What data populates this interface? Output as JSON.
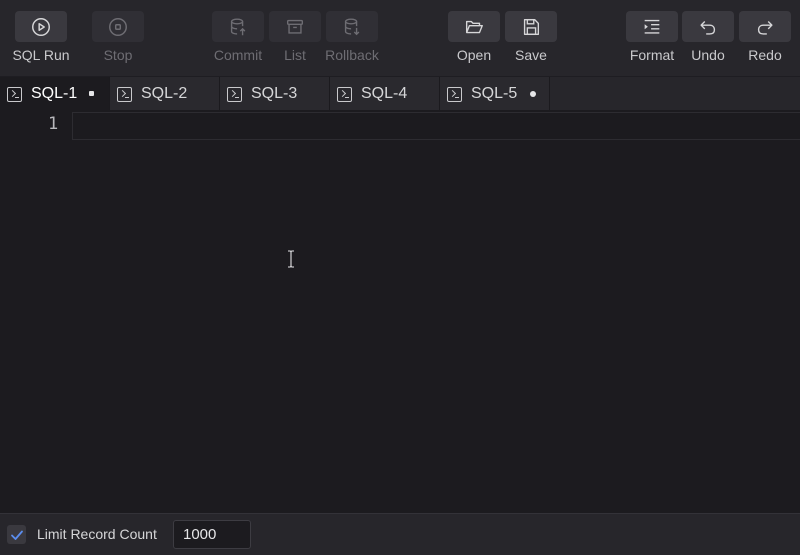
{
  "toolbar": {
    "sql_run": "SQL Run",
    "stop": "Stop",
    "commit": "Commit",
    "list": "List",
    "rollback": "Rollback",
    "open": "Open",
    "save": "Save",
    "format": "Format",
    "undo": "Undo",
    "redo": "Redo"
  },
  "tabs": [
    {
      "label": "SQL-1",
      "active": true,
      "modified_indicator": "square"
    },
    {
      "label": "SQL-2",
      "active": false
    },
    {
      "label": "SQL-3",
      "active": false
    },
    {
      "label": "SQL-4",
      "active": false
    },
    {
      "label": "SQL-5",
      "active": false,
      "modified_indicator": "dot"
    }
  ],
  "editor": {
    "line_numbers": [
      "1"
    ],
    "content": ""
  },
  "footer": {
    "limit_label": "Limit Record Count",
    "limit_checked": true,
    "limit_value": "1000"
  },
  "colors": {
    "background": "#1c1b1f",
    "toolbar": "#27262b",
    "button": "#3a393f",
    "checkbox_mark": "#5b8def"
  }
}
